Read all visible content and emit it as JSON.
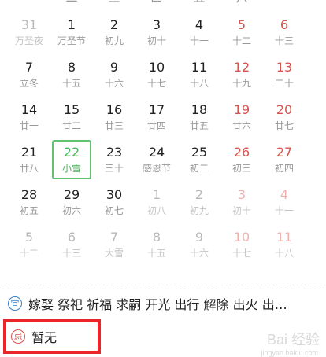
{
  "weekdays": [
    "二",
    "三",
    "四",
    "五",
    "六"
  ],
  "weeks": [
    [
      {
        "n": "31",
        "s": "万圣夜",
        "m": true
      },
      {
        "n": "1",
        "s": "万圣节"
      },
      {
        "n": "2",
        "s": "初九"
      },
      {
        "n": "3",
        "s": "初十"
      },
      {
        "n": "4",
        "s": "十一"
      },
      {
        "n": "5",
        "s": "十二",
        "w": true
      },
      {
        "n": "6",
        "s": "十三",
        "w": true
      }
    ],
    [
      {
        "n": "7",
        "s": "立冬"
      },
      {
        "n": "8",
        "s": "十五"
      },
      {
        "n": "9",
        "s": "十六"
      },
      {
        "n": "10",
        "s": "十七"
      },
      {
        "n": "11",
        "s": "十八"
      },
      {
        "n": "12",
        "s": "十九",
        "w": true
      },
      {
        "n": "13",
        "s": "二十",
        "w": true
      }
    ],
    [
      {
        "n": "14",
        "s": "廿一"
      },
      {
        "n": "15",
        "s": "廿二"
      },
      {
        "n": "16",
        "s": "廿三"
      },
      {
        "n": "17",
        "s": "廿四"
      },
      {
        "n": "18",
        "s": "廿五"
      },
      {
        "n": "19",
        "s": "廿六",
        "w": true
      },
      {
        "n": "20",
        "s": "廿七",
        "w": true
      }
    ],
    [
      {
        "n": "21",
        "s": "廿八"
      },
      {
        "n": "22",
        "s": "小雪",
        "t": true
      },
      {
        "n": "23",
        "s": "三十"
      },
      {
        "n": "24",
        "s": "感恩节"
      },
      {
        "n": "25",
        "s": "初二"
      },
      {
        "n": "26",
        "s": "初三",
        "w": true
      },
      {
        "n": "27",
        "s": "初四",
        "w": true
      }
    ],
    [
      {
        "n": "28",
        "s": "初五"
      },
      {
        "n": "29",
        "s": "初六"
      },
      {
        "n": "30",
        "s": "初七"
      },
      {
        "n": "1",
        "s": "初八",
        "m": true
      },
      {
        "n": "2",
        "s": "初九",
        "m": true
      },
      {
        "n": "3",
        "s": "初十",
        "w": true,
        "m": true
      },
      {
        "n": "4",
        "s": "十一",
        "w": true,
        "m": true
      }
    ],
    [
      {
        "n": "5",
        "s": "十二",
        "m": true
      },
      {
        "n": "6",
        "s": "十三",
        "m": true
      },
      {
        "n": "7",
        "s": "大雪",
        "m": true
      },
      {
        "n": "8",
        "s": "十五",
        "m": true
      },
      {
        "n": "9",
        "s": "十六",
        "m": true
      },
      {
        "n": "10",
        "s": "十七",
        "w": true,
        "m": true
      },
      {
        "n": "11",
        "s": "十八",
        "w": true,
        "m": true
      }
    ]
  ],
  "yi": {
    "badge": "宜",
    "text": "嫁娶 祭祀 祈福 求嗣 开光 出行 解除 出火 出…"
  },
  "ji": {
    "badge": "忌",
    "text": "暂无"
  },
  "watermark": {
    "main": "Bai 经验",
    "sub": "jingyan.baidu.com"
  }
}
